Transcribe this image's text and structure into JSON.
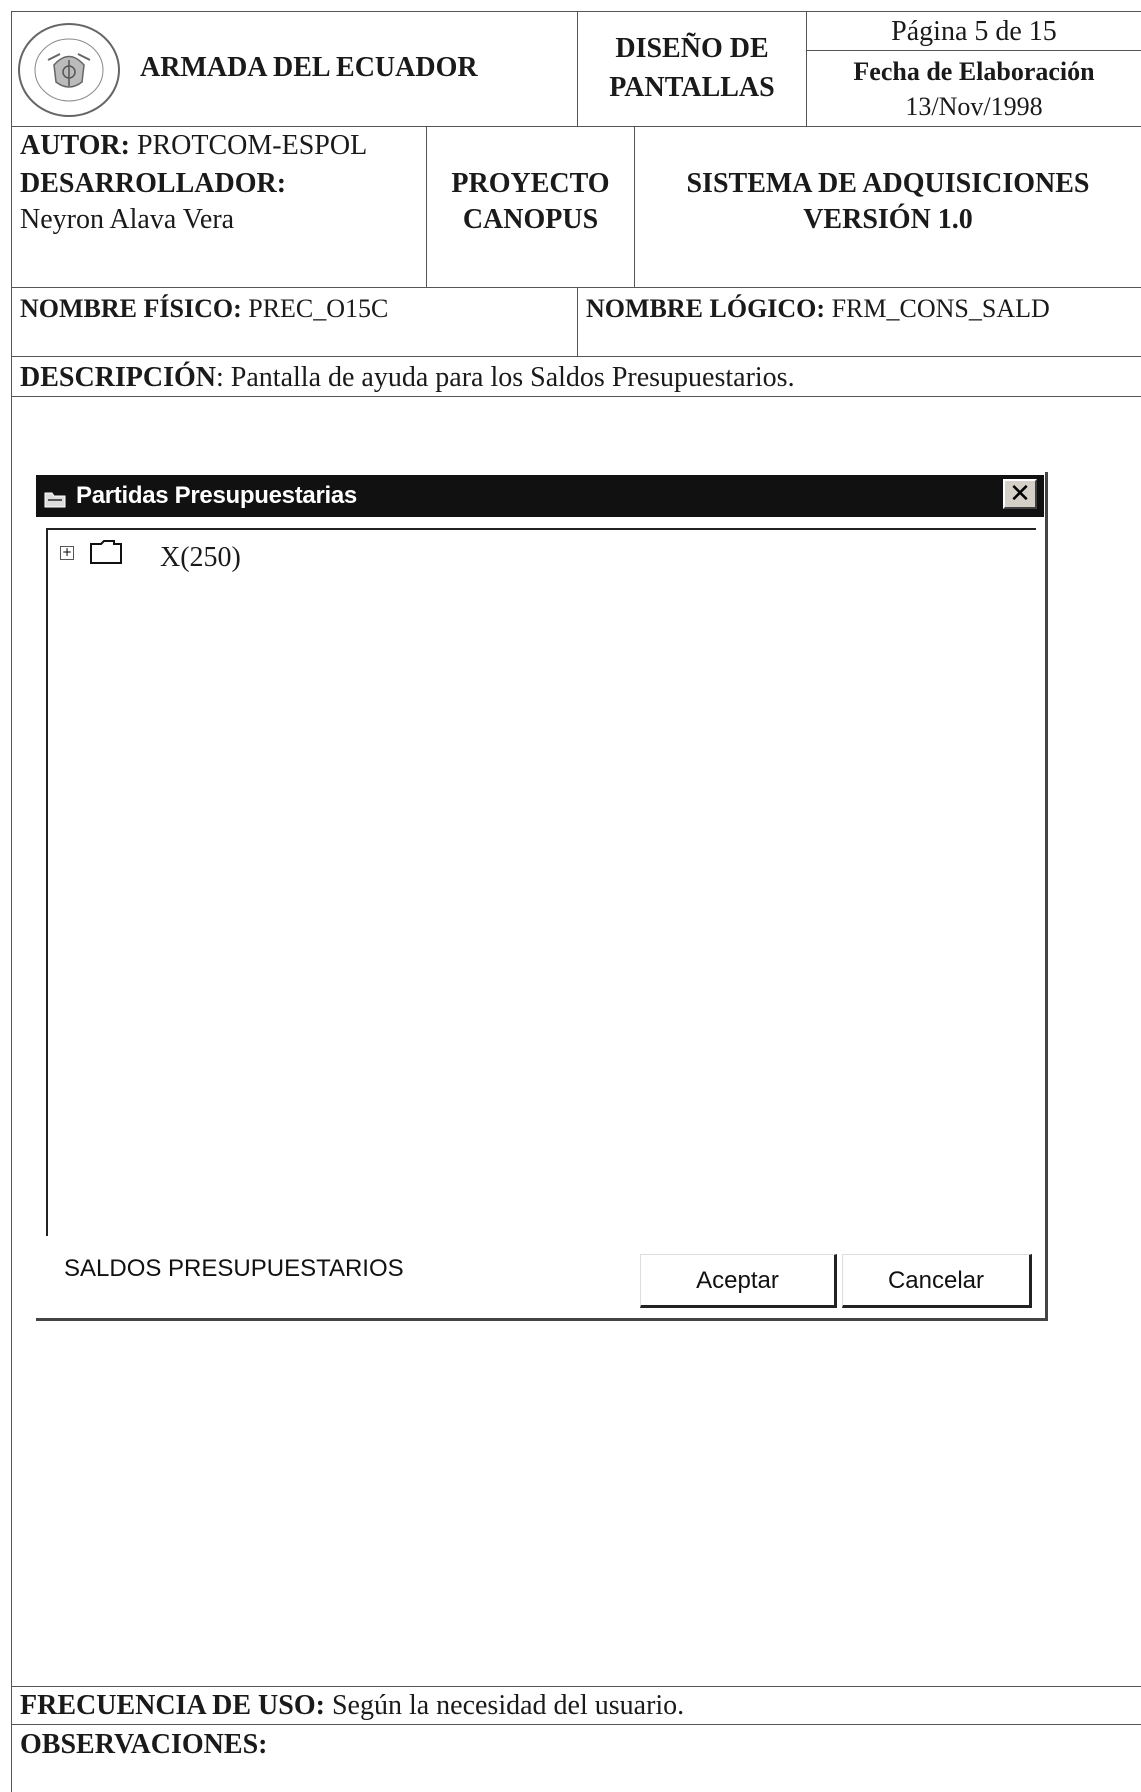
{
  "header": {
    "organization": "ARMADA DEL ECUADOR",
    "seal_text": "ARMADA DEL ECUADOR",
    "doc_type_line1": "DISEÑO DE",
    "doc_type_line2": "PANTALLAS",
    "page": "Página 5 de 15",
    "date_label": "Fecha de Elaboración",
    "date_value": "13/Nov/1998"
  },
  "authors": {
    "autor_label": "AUTOR:",
    "autor_value": "PROTCOM-ESPOL",
    "dev_label": "DESARROLLADOR:",
    "dev_value": "Neyron Alava Vera",
    "project_line1": "PROYECTO",
    "project_line2": "CANOPUS",
    "system_line1": "SISTEMA DE ADQUISICIONES",
    "system_line2": "VERSIÓN 1.0"
  },
  "names": {
    "physical_label": "NOMBRE FÍSICO:",
    "physical_value": "PREC_O15C",
    "logical_label": "NOMBRE LÓGICO:",
    "logical_value": "FRM_CONS_SALD"
  },
  "description": {
    "label": "DESCRIPCIÓN",
    "text": ": Pantalla de ayuda para los Saldos Presupuestarios."
  },
  "dialog": {
    "title": "Partidas Presupuestarias",
    "close_glyph": "✕",
    "tree_node": "X(250)",
    "expand_glyph": "+",
    "status_label": "SALDOS PRESUPUESTARIOS",
    "accept_button": "Aceptar",
    "cancel_button": "Cancelar"
  },
  "footer": {
    "frequency_label": "FRECUENCIA DE USO:",
    "frequency_value": "Según la necesidad del usuario.",
    "observations_label": "OBSERVACIONES:"
  }
}
